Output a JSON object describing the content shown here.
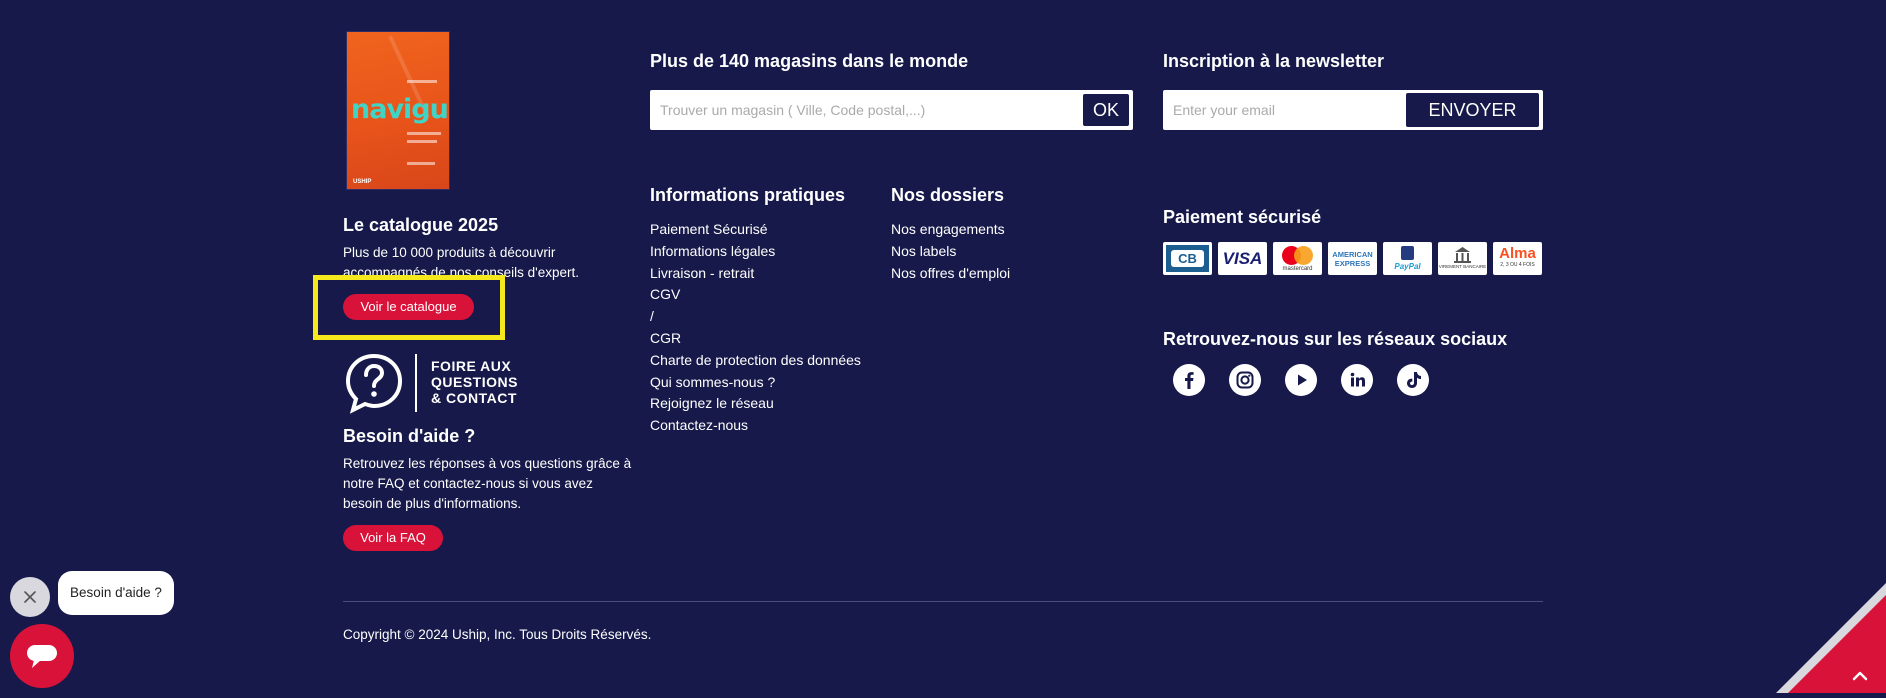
{
  "catalogue": {
    "cover_brand": "navigue",
    "cover_footer": "USHIP",
    "title": "Le catalogue 2025",
    "description_line1": "Plus de 10 000 produits à découvrir",
    "description_line2": "accompagnés de nos conseils d'expert.",
    "button_label": "Voir le catalogue"
  },
  "faq_logo": {
    "line1": "FOIRE AUX",
    "line2": "QUESTIONS",
    "line3": "& CONTACT"
  },
  "help": {
    "title": "Besoin d'aide ?",
    "description_line1": "Retrouvez les réponses à vos questions grâce à",
    "description_line2": "notre FAQ et contactez-nous si vous avez",
    "description_line3": "besoin de plus d'informations.",
    "button_label": "Voir la FAQ"
  },
  "stores": {
    "title": "Plus de 140 magasins dans le monde",
    "placeholder": "Trouver un magasin ( Ville, Code postal,...)",
    "button_label": "OK"
  },
  "newsletter": {
    "title": "Inscription à la newsletter",
    "placeholder": "Enter your email",
    "button_label": "ENVOYER"
  },
  "info": {
    "title": "Informations pratiques",
    "links": [
      "Paiement Sécurisé",
      "Informations légales",
      "Livraison - retrait",
      "CGV",
      "/",
      "CGR",
      "Charte de protection des données",
      "Qui sommes-nous ?",
      "Rejoignez le réseau",
      "Contactez-nous"
    ]
  },
  "dossiers": {
    "title": "Nos dossiers",
    "links": [
      "Nos engagements",
      "Nos labels",
      "Nos offres d'emploi"
    ]
  },
  "payment": {
    "title": "Paiement sécurisé",
    "cards": {
      "cb": "CB",
      "visa": "VISA",
      "mastercard": "mastercard",
      "amex": "AMERICAN EXPRESS",
      "paypal": "PayPal",
      "virement": "VIREMENT BANCAIRE",
      "alma": "Alma",
      "alma_sub": "2, 3 OU 4 FOIS"
    }
  },
  "social": {
    "title": "Retrouvez-nous sur les réseaux sociaux",
    "icons": [
      "facebook-icon",
      "instagram-icon",
      "youtube-icon",
      "linkedin-icon",
      "tiktok-icon"
    ]
  },
  "copyright": "Copyright © 2024 Uship, Inc. Tous Droits Réservés.",
  "chat_widget": {
    "bubble_text": "Besoin d'aide ?"
  },
  "colors": {
    "background": "#161949",
    "accent": "#d9123a",
    "highlight": "#f5e81c"
  }
}
